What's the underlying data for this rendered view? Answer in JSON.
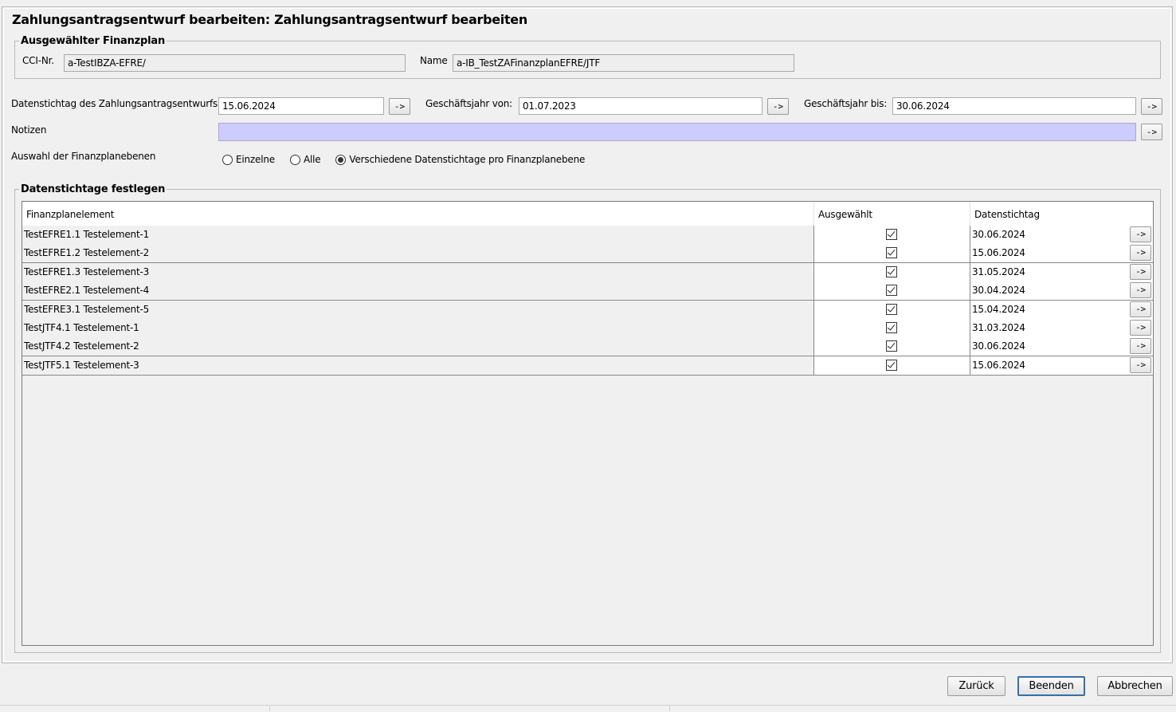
{
  "window": {
    "title": "Zahlungsantragsentwurf bearbeiten: Zahlungsantragsentwurf bearbeiten"
  },
  "finanzplan": {
    "group_title": "Ausgewählter Finanzplan",
    "cci_label": "CCI-Nr.",
    "cci_value": "a-TestIBZA-EFRE/",
    "name_label": "Name",
    "name_value": "a-IB_TestZAFinanzplanEFRE/JTF"
  },
  "form": {
    "datenstichtag_label": "Datenstichtag des Zahlungsantragsentwurfs",
    "datenstichtag_value": "15.06.2024",
    "gj_von_label": "Geschäftsjahr von:",
    "gj_von_value": "01.07.2023",
    "gj_bis_label": "Geschäftsjahr bis:",
    "gj_bis_value": "30.06.2024",
    "notizen_label": "Notizen",
    "notizen_value": "",
    "arrow_label": "->",
    "auswahl_label": "Auswahl der Finanzplanebenen",
    "radio_options": [
      {
        "label": "Einzelne",
        "selected": false
      },
      {
        "label": "Alle",
        "selected": false
      },
      {
        "label": "Verschiedene Datenstichtage pro Finanzplanebene",
        "selected": true
      }
    ]
  },
  "stichtage": {
    "group_title": "Datenstichtage festlegen",
    "columns": [
      "Finanzplanelement",
      "Ausgewählt",
      "Datenstichtag"
    ],
    "rows": [
      {
        "element": "TestEFRE1.1 Testelement-1",
        "selected": true,
        "date": "30.06.2024"
      },
      {
        "element": "TestEFRE1.2 Testelement-2",
        "selected": true,
        "date": "15.06.2024"
      },
      {
        "element": "TestEFRE1.3 Testelement-3",
        "selected": true,
        "date": "31.05.2024"
      },
      {
        "element": "TestEFRE2.1 Testelement-4",
        "selected": true,
        "date": "30.04.2024"
      },
      {
        "element": "TestEFRE3.1 Testelement-5",
        "selected": true,
        "date": "15.04.2024"
      },
      {
        "element": "TestJTF4.1 Testelement-1",
        "selected": true,
        "date": "31.03.2024"
      },
      {
        "element": "TestJTF4.2 Testelement-2",
        "selected": true,
        "date": "30.06.2024"
      },
      {
        "element": "TestJTF5.1 Testelement-3",
        "selected": true,
        "date": "15.06.2024"
      }
    ]
  },
  "buttons": {
    "back": "Zurück",
    "finish": "Beenden",
    "cancel": "Abbrechen"
  }
}
